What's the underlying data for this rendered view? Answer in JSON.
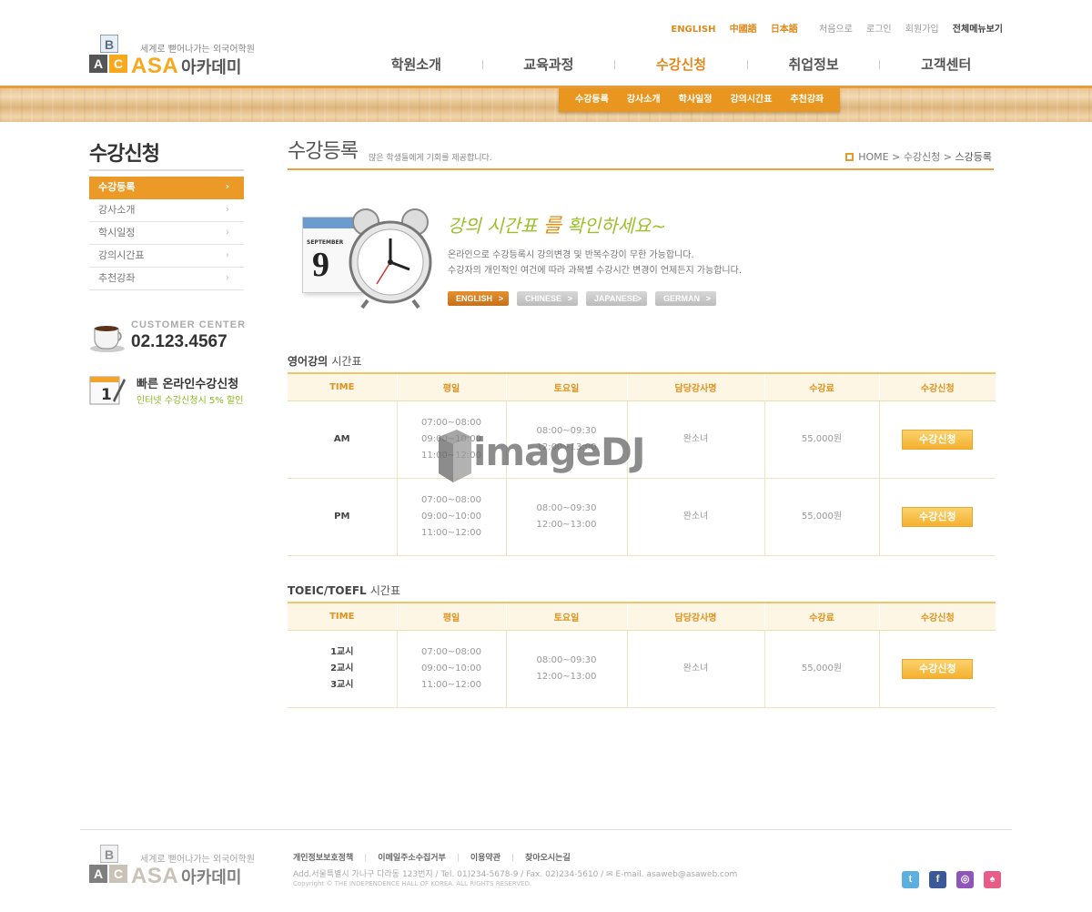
{
  "brand": {
    "tagline": "세계로 뻗어나가는 외국어학원",
    "name_en": "ASA",
    "name_kr": "아카데미",
    "blocks": [
      "B",
      "A",
      "C"
    ]
  },
  "toplinks": {
    "lang": [
      "ENGLISH",
      "中國語",
      "日本語"
    ],
    "util": [
      "처음으로",
      "로그인",
      "회원가입"
    ],
    "sitemap": "전체메뉴보기"
  },
  "gnb": [
    "학원소개",
    "교육과정",
    "수강신청",
    "취업정보",
    "고객센터"
  ],
  "subnav": [
    "수강등록",
    "강사소개",
    "학사일정",
    "강의시간표",
    "추천강좌"
  ],
  "sidebar": {
    "title": "수강신청",
    "items": [
      "수강등록",
      "강사소개",
      "학시일정",
      "강의시간표",
      "추천강좌"
    ],
    "arrow": "›",
    "customer_label": "CUSTOMER CENTER",
    "customer_phone": "02.123.4567",
    "online_prefix": "빠른",
    "online_title": "온라인수강신청",
    "online_sub": "인터넷 수강신청시 5% 할인",
    "cal_num": "1"
  },
  "content": {
    "title": "수강등록",
    "subtitle": "많은 학생들에게 기회를 제공합니다.",
    "breadcrumb": {
      "home": "HOME",
      "sep": ">",
      "mid": "수강신청",
      "current": "스강등록"
    },
    "promo": {
      "head1": "강의 시간표",
      "head2": "를",
      "head3": "확인하세요~",
      "desc1": "온라인으로 수강등록시 강의변경 및 반복수강이 무한 가능합니다.",
      "desc2": "수강자의 개인적인 여건에 따라 과목별 수강시간 변경이 언제든지 가능합니다.",
      "cal_month": "SEPTEMBER",
      "cal_day": "9",
      "langs": [
        "ENGLISH",
        "CHINESE",
        "JAPANESE",
        "GERMAN"
      ],
      "lang_arrow": ">"
    }
  },
  "english_table": {
    "title_bold": "영어강의",
    "title_thin": "시간표",
    "headers": [
      "TIME",
      "평일",
      "토요일",
      "담당강사명",
      "수강료",
      "수강신청"
    ],
    "rows": [
      {
        "time": "AM",
        "weekday": [
          "07:00~08:00",
          "09:00~10:00",
          "11:00~12:00"
        ],
        "saturday": [
          "08:00~09:30",
          "12:00~13:00"
        ],
        "teacher": "완소녀",
        "fee": "55,000원",
        "button": "수강신청"
      },
      {
        "time": "PM",
        "weekday": [
          "07:00~08:00",
          "09:00~10:00",
          "11:00~12:00"
        ],
        "saturday": [
          "08:00~09:30",
          "12:00~13:00"
        ],
        "teacher": "완소녀",
        "fee": "55,000원",
        "button": "수강신청"
      }
    ]
  },
  "toeic_table": {
    "title_bold": "TOEIC/TOEFL",
    "title_thin": "시간표",
    "headers": [
      "TIME",
      "평일",
      "토요일",
      "담당강사명",
      "수강료",
      "수강신청"
    ],
    "rows": [
      {
        "time": [
          "1교시",
          "2교시",
          "3교시"
        ],
        "weekday": [
          "07:00~08:00",
          "09:00~10:00",
          "11:00~12:00"
        ],
        "saturday": [
          "08:00~09:30",
          "12:00~13:00"
        ],
        "teacher": "완소녀",
        "fee": "55,000원",
        "button": "수강신청"
      }
    ]
  },
  "watermark": "imageDJ",
  "footer": {
    "links": [
      "개인정보보호정책",
      "이메일주소수집거부",
      "이용약관",
      "찾아오시는길"
    ],
    "address": "Add.서울특별시 가나구 다라동 123번지  / Tel. 01)234-5678-9  / Fax. 02)234-5610  /  ✉ E-mail. asaweb@asaweb.com",
    "copyright": "Copyright © THE INDEPENDENCE HALL OF KOREA. ALL RIGHTS RESERVED.",
    "sns": [
      "t",
      "f",
      "◎",
      "♠"
    ]
  },
  "colors": {
    "accent": "#e8961f",
    "green": "#9cbf2a",
    "twitter": "#5bb0dd",
    "facebook": "#3b5998",
    "me2day": "#8e56b8",
    "other": "#e85c88"
  }
}
